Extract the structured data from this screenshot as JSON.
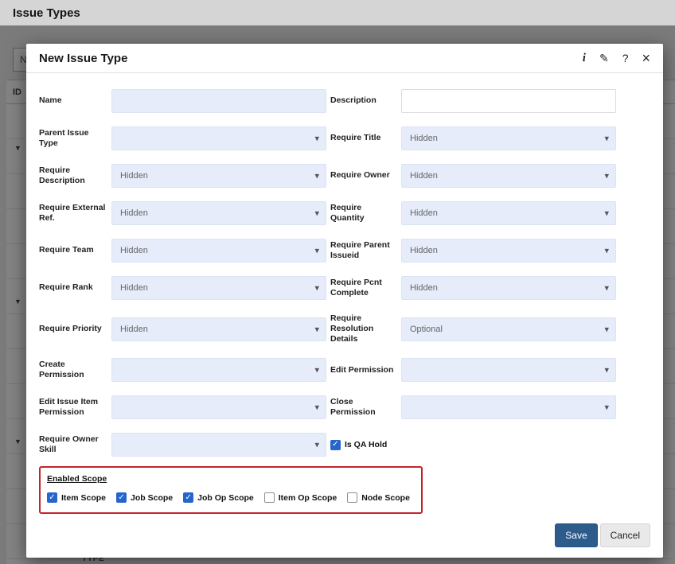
{
  "page": {
    "header_title": "Issue Types"
  },
  "background": {
    "filter_text": "N",
    "id_header": "ID",
    "type_header": "TYPE"
  },
  "icons": {
    "info": "i",
    "edit": "✎",
    "help": "?",
    "close": "×",
    "select_arrow": "▾",
    "check": "✓",
    "row_chevron": "▼"
  },
  "modal": {
    "title": "New Issue Type",
    "rows": [
      {
        "left": {
          "label": "Name",
          "type": "text",
          "value": "",
          "variant": "lavender"
        },
        "right": {
          "label": "Description",
          "type": "text",
          "value": "",
          "variant": "white"
        }
      },
      {
        "left": {
          "label": "Parent Issue Type",
          "type": "select",
          "value": ""
        },
        "right": {
          "label": "Require Title",
          "type": "select",
          "value": "Hidden"
        }
      },
      {
        "left": {
          "label": "Require Description",
          "type": "select",
          "value": "Hidden"
        },
        "right": {
          "label": "Require Owner",
          "type": "select",
          "value": "Hidden"
        }
      },
      {
        "left": {
          "label": "Require External Ref.",
          "type": "select",
          "value": "Hidden"
        },
        "right": {
          "label": "Require Quantity",
          "type": "select",
          "value": "Hidden"
        }
      },
      {
        "left": {
          "label": "Require Team",
          "type": "select",
          "value": "Hidden"
        },
        "right": {
          "label": "Require Parent Issueid",
          "type": "select",
          "value": "Hidden"
        }
      },
      {
        "left": {
          "label": "Require Rank",
          "type": "select",
          "value": "Hidden"
        },
        "right": {
          "label": "Require Pcnt Complete",
          "type": "select",
          "value": "Hidden"
        }
      },
      {
        "left": {
          "label": "Require Priority",
          "type": "select",
          "value": "Hidden"
        },
        "right": {
          "label": "Require Resolution Details",
          "type": "select",
          "value": "Optional"
        }
      },
      {
        "left": {
          "label": "Create Permission",
          "type": "select",
          "value": ""
        },
        "right": {
          "label": "Edit Permission",
          "type": "select",
          "value": ""
        }
      },
      {
        "left": {
          "label": "Edit Issue Item Permission",
          "type": "select",
          "value": ""
        },
        "right": {
          "label": "Close Permission",
          "type": "select",
          "value": ""
        }
      },
      {
        "left": {
          "label": "Require Owner Skill",
          "type": "select",
          "value": ""
        },
        "right": {
          "label": "Is QA Hold",
          "type": "checkbox",
          "checked": true
        }
      }
    ],
    "enabled_scope": {
      "heading": "Enabled Scope",
      "options": [
        {
          "label": "Item Scope",
          "checked": true
        },
        {
          "label": "Job Scope",
          "checked": true
        },
        {
          "label": "Job Op Scope",
          "checked": true
        },
        {
          "label": "Item Op Scope",
          "checked": false
        },
        {
          "label": "Node Scope",
          "checked": false
        }
      ]
    },
    "footer": {
      "save_label": "Save",
      "cancel_label": "Cancel"
    }
  },
  "colors": {
    "accent_blue": "#2d5c8c",
    "field_bg": "#e6ecf9",
    "highlight_red": "#c4232b",
    "checkbox_blue": "#2665cc",
    "overlay": "rgba(20,20,20,0.52)"
  }
}
